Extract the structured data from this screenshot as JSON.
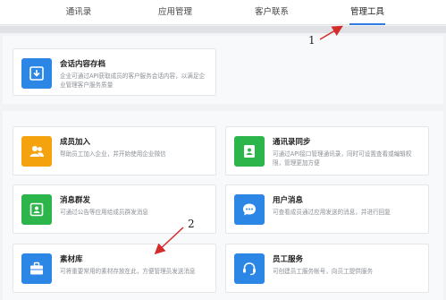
{
  "tabs": [
    {
      "label": "通讯录",
      "active": false
    },
    {
      "label": "应用管理",
      "active": false
    },
    {
      "label": "客户联系",
      "active": false
    },
    {
      "label": "管理工具",
      "active": true
    }
  ],
  "cards": {
    "archive": {
      "title": "会话内容存档",
      "desc": "企业可通过API获取成员的客户服务会话内容，以满足企业管理客户服务质量",
      "icon": "archive-download-icon",
      "color": "#2b86e6"
    },
    "member_join": {
      "title": "成员加入",
      "desc": "帮助员工加入企业，并开始使用企业微信",
      "icon": "people-icon",
      "color": "#f5a20f"
    },
    "contacts_sync": {
      "title": "通讯录同步",
      "desc": "可通过API接口管理通讯录，同时可设置查看或编辑权限，管理更加方便",
      "icon": "contact-sync-icon",
      "color": "#2cb54a"
    },
    "broadcast": {
      "title": "消息群发",
      "desc": "可通过公告等应用给成员群发消息",
      "icon": "contact-card-icon",
      "color": "#2cb54a"
    },
    "user_messages": {
      "title": "用户消息",
      "desc": "可查看成员通过应用发送的消息，并进行回复",
      "icon": "chat-bubble-icon",
      "color": "#2b86e6"
    },
    "library": {
      "title": "素材库",
      "desc": "可将重要常用的素材存放在此，方便管理员发送消息",
      "icon": "briefcase-icon",
      "color": "#2b86e6"
    },
    "staff_service": {
      "title": "员工服务",
      "desc": "可创建员工服务帐号，向员工提供服务",
      "icon": "headset-icon",
      "color": "#2b86e6"
    }
  },
  "annotations": [
    "1",
    "2"
  ]
}
